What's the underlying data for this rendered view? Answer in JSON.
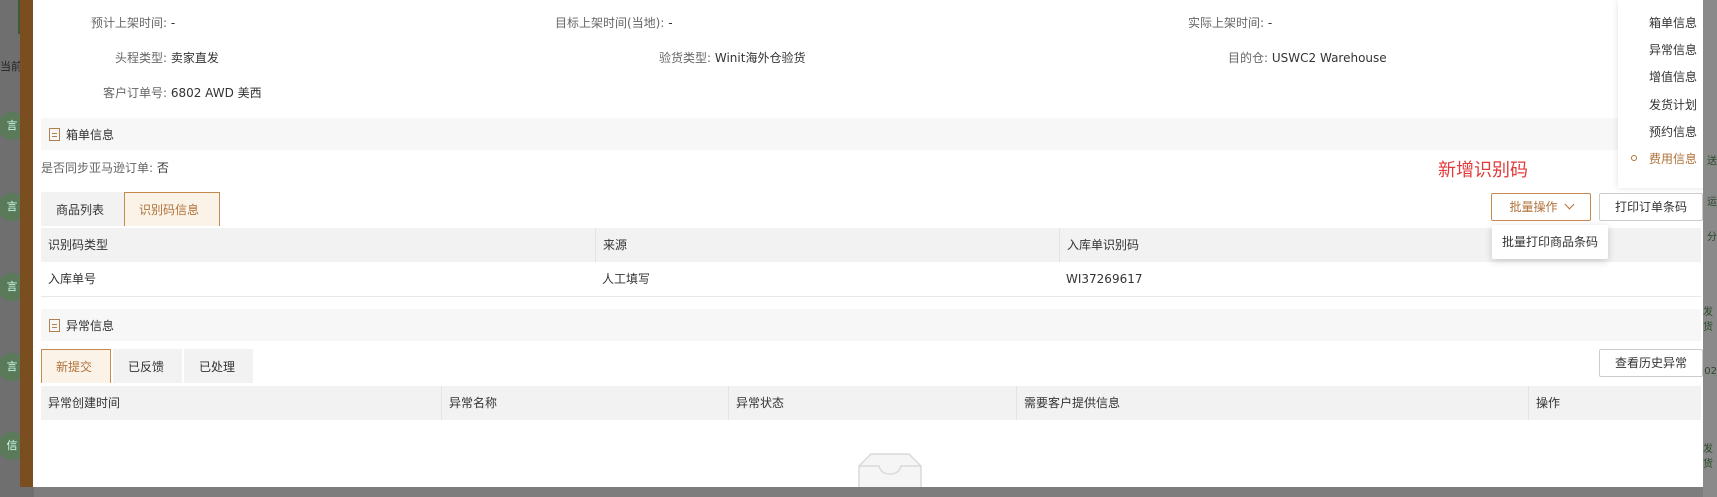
{
  "background": {
    "left_fragments": [
      "当前",
      "言",
      "言",
      "言",
      "言",
      "信"
    ],
    "right_fragments": [
      "送",
      "运",
      "分",
      "发货",
      "02",
      "发货"
    ]
  },
  "order_info": {
    "row1": [
      {
        "label": "预计上架时间:",
        "value": "-"
      },
      {
        "label": "目标上架时间(当地):",
        "value": "-"
      },
      {
        "label": "实际上架时间:",
        "value": "-"
      }
    ],
    "row2": [
      {
        "label": "头程类型:",
        "value": "卖家直发"
      },
      {
        "label": "验货类型:",
        "value": "Winit海外仓验货"
      },
      {
        "label": "目的仓:",
        "value": "USWC2 Warehouse"
      }
    ],
    "row3": [
      {
        "label": "客户订单号:",
        "value": "6802 AWD 美西"
      }
    ]
  },
  "box_section": {
    "title": "箱单信息",
    "sync_label": "是否同步亚马逊订单:",
    "sync_value": "否",
    "tabs": [
      {
        "label": "商品列表",
        "active": false
      },
      {
        "label": "识别码信息",
        "active": true
      }
    ],
    "annotation": "新增识别码",
    "batch_button": "批量操作",
    "print_button": "打印订单条码",
    "dropdown_item": "批量打印商品条码",
    "table": {
      "headers": [
        "识别码类型",
        "来源",
        "入库单识别码"
      ],
      "rows": [
        [
          "入库单号",
          "人工填写",
          "WI37269617"
        ]
      ]
    }
  },
  "exception_section": {
    "title": "异常信息",
    "tabs": [
      {
        "label": "新提交",
        "active": true
      },
      {
        "label": "已反馈",
        "active": false
      },
      {
        "label": "已处理",
        "active": false
      }
    ],
    "history_button": "查看历史异常",
    "table": {
      "headers": [
        "异常创建时间",
        "异常名称",
        "异常状态",
        "需要客户提供信息",
        "操作"
      ],
      "rows": []
    }
  },
  "anchor_nav": {
    "items": [
      {
        "label": "箱单信息",
        "active": false
      },
      {
        "label": "异常信息",
        "active": false
      },
      {
        "label": "增值信息",
        "active": false
      },
      {
        "label": "发货计划",
        "active": false
      },
      {
        "label": "预约信息",
        "active": false
      },
      {
        "label": "费用信息",
        "active": true
      }
    ]
  },
  "colors": {
    "accent": "#b0723a",
    "annotation": "#e23b3b",
    "sidebar_brown": "#7a4e1e"
  }
}
